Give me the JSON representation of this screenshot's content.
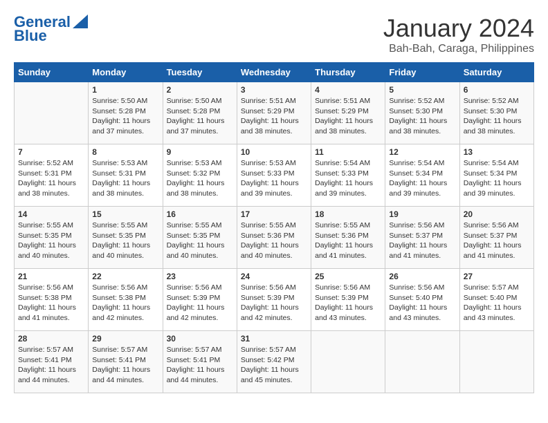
{
  "logo": {
    "line1": "General",
    "line2": "Blue"
  },
  "title": "January 2024",
  "subtitle": "Bah-Bah, Caraga, Philippines",
  "headers": [
    "Sunday",
    "Monday",
    "Tuesday",
    "Wednesday",
    "Thursday",
    "Friday",
    "Saturday"
  ],
  "weeks": [
    [
      {
        "day": "",
        "info": ""
      },
      {
        "day": "1",
        "info": "Sunrise: 5:50 AM\nSunset: 5:28 PM\nDaylight: 11 hours\nand 37 minutes."
      },
      {
        "day": "2",
        "info": "Sunrise: 5:50 AM\nSunset: 5:28 PM\nDaylight: 11 hours\nand 37 minutes."
      },
      {
        "day": "3",
        "info": "Sunrise: 5:51 AM\nSunset: 5:29 PM\nDaylight: 11 hours\nand 38 minutes."
      },
      {
        "day": "4",
        "info": "Sunrise: 5:51 AM\nSunset: 5:29 PM\nDaylight: 11 hours\nand 38 minutes."
      },
      {
        "day": "5",
        "info": "Sunrise: 5:52 AM\nSunset: 5:30 PM\nDaylight: 11 hours\nand 38 minutes."
      },
      {
        "day": "6",
        "info": "Sunrise: 5:52 AM\nSunset: 5:30 PM\nDaylight: 11 hours\nand 38 minutes."
      }
    ],
    [
      {
        "day": "7",
        "info": "Sunrise: 5:52 AM\nSunset: 5:31 PM\nDaylight: 11 hours\nand 38 minutes."
      },
      {
        "day": "8",
        "info": "Sunrise: 5:53 AM\nSunset: 5:31 PM\nDaylight: 11 hours\nand 38 minutes."
      },
      {
        "day": "9",
        "info": "Sunrise: 5:53 AM\nSunset: 5:32 PM\nDaylight: 11 hours\nand 38 minutes."
      },
      {
        "day": "10",
        "info": "Sunrise: 5:53 AM\nSunset: 5:33 PM\nDaylight: 11 hours\nand 39 minutes."
      },
      {
        "day": "11",
        "info": "Sunrise: 5:54 AM\nSunset: 5:33 PM\nDaylight: 11 hours\nand 39 minutes."
      },
      {
        "day": "12",
        "info": "Sunrise: 5:54 AM\nSunset: 5:34 PM\nDaylight: 11 hours\nand 39 minutes."
      },
      {
        "day": "13",
        "info": "Sunrise: 5:54 AM\nSunset: 5:34 PM\nDaylight: 11 hours\nand 39 minutes."
      }
    ],
    [
      {
        "day": "14",
        "info": "Sunrise: 5:55 AM\nSunset: 5:35 PM\nDaylight: 11 hours\nand 40 minutes."
      },
      {
        "day": "15",
        "info": "Sunrise: 5:55 AM\nSunset: 5:35 PM\nDaylight: 11 hours\nand 40 minutes."
      },
      {
        "day": "16",
        "info": "Sunrise: 5:55 AM\nSunset: 5:35 PM\nDaylight: 11 hours\nand 40 minutes."
      },
      {
        "day": "17",
        "info": "Sunrise: 5:55 AM\nSunset: 5:36 PM\nDaylight: 11 hours\nand 40 minutes."
      },
      {
        "day": "18",
        "info": "Sunrise: 5:55 AM\nSunset: 5:36 PM\nDaylight: 11 hours\nand 41 minutes."
      },
      {
        "day": "19",
        "info": "Sunrise: 5:56 AM\nSunset: 5:37 PM\nDaylight: 11 hours\nand 41 minutes."
      },
      {
        "day": "20",
        "info": "Sunrise: 5:56 AM\nSunset: 5:37 PM\nDaylight: 11 hours\nand 41 minutes."
      }
    ],
    [
      {
        "day": "21",
        "info": "Sunrise: 5:56 AM\nSunset: 5:38 PM\nDaylight: 11 hours\nand 41 minutes."
      },
      {
        "day": "22",
        "info": "Sunrise: 5:56 AM\nSunset: 5:38 PM\nDaylight: 11 hours\nand 42 minutes."
      },
      {
        "day": "23",
        "info": "Sunrise: 5:56 AM\nSunset: 5:39 PM\nDaylight: 11 hours\nand 42 minutes."
      },
      {
        "day": "24",
        "info": "Sunrise: 5:56 AM\nSunset: 5:39 PM\nDaylight: 11 hours\nand 42 minutes."
      },
      {
        "day": "25",
        "info": "Sunrise: 5:56 AM\nSunset: 5:39 PM\nDaylight: 11 hours\nand 43 minutes."
      },
      {
        "day": "26",
        "info": "Sunrise: 5:56 AM\nSunset: 5:40 PM\nDaylight: 11 hours\nand 43 minutes."
      },
      {
        "day": "27",
        "info": "Sunrise: 5:57 AM\nSunset: 5:40 PM\nDaylight: 11 hours\nand 43 minutes."
      }
    ],
    [
      {
        "day": "28",
        "info": "Sunrise: 5:57 AM\nSunset: 5:41 PM\nDaylight: 11 hours\nand 44 minutes."
      },
      {
        "day": "29",
        "info": "Sunrise: 5:57 AM\nSunset: 5:41 PM\nDaylight: 11 hours\nand 44 minutes."
      },
      {
        "day": "30",
        "info": "Sunrise: 5:57 AM\nSunset: 5:41 PM\nDaylight: 11 hours\nand 44 minutes."
      },
      {
        "day": "31",
        "info": "Sunrise: 5:57 AM\nSunset: 5:42 PM\nDaylight: 11 hours\nand 45 minutes."
      },
      {
        "day": "",
        "info": ""
      },
      {
        "day": "",
        "info": ""
      },
      {
        "day": "",
        "info": ""
      }
    ]
  ]
}
